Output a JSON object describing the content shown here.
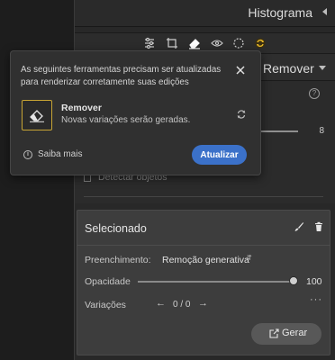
{
  "histogram": {
    "title": "Histograma"
  },
  "toolstrip": {
    "tools": [
      "sliders-icon",
      "crop-icon",
      "eraser-icon",
      "redeye-icon",
      "masking-icon",
      "update-badge-icon"
    ]
  },
  "remover_panel": {
    "title": "Remover",
    "size_value": "8",
    "detect_objects_label": "Detectar objetos"
  },
  "popup": {
    "message": "As seguintes ferramentas precisam ser atualizadas para renderizar corretamente suas edições",
    "tool_name": "Remover",
    "tool_desc": "Novas variações serão geradas.",
    "learn_more": "Saiba mais",
    "update_button": "Atualizar"
  },
  "selected_panel": {
    "title": "Selecionado",
    "fill_label": "Preenchimento:",
    "fill_value": "Remoção generativa",
    "opacity_label": "Opacidade",
    "opacity_value": "100",
    "opacity_level": 1.0,
    "variations_label": "Variações",
    "variations_count": "0 / 0",
    "more": "···",
    "generate_button": "Gerar"
  },
  "colors": {
    "accent": "#3b71c9",
    "highlight": "#c8a534",
    "panel": "#3d3d3d"
  }
}
